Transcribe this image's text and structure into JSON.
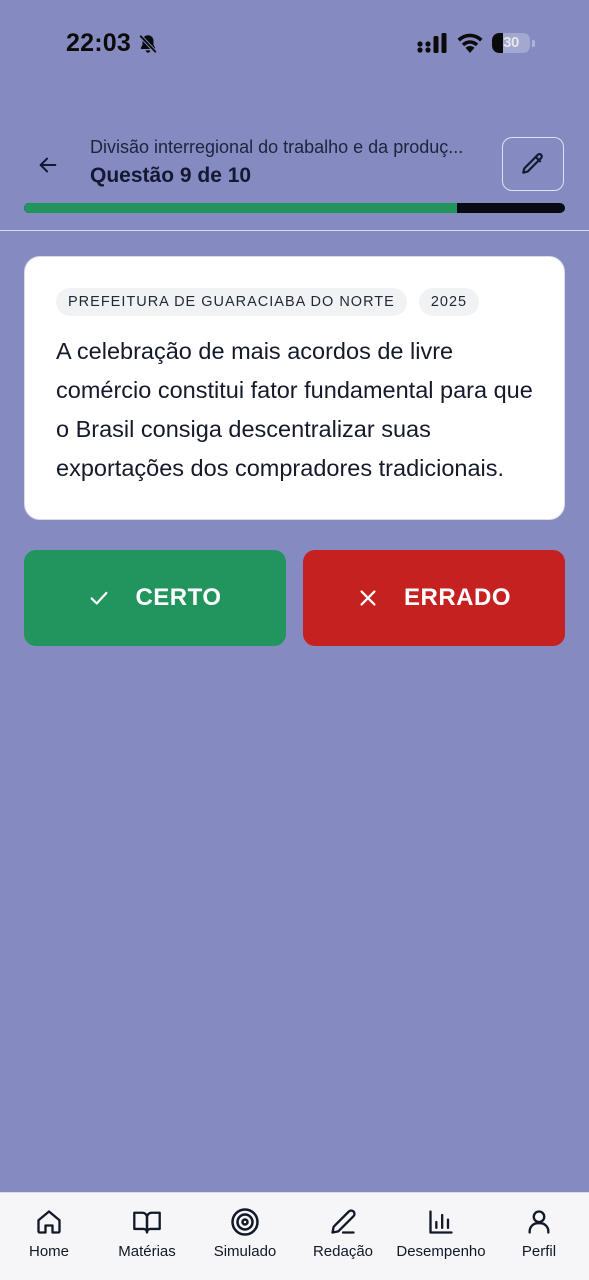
{
  "status_bar": {
    "time": "22:03",
    "battery_level": "30",
    "battery_fraction": 0.3,
    "icons": [
      "bell-slash-icon",
      "signal-icon",
      "wifi-icon",
      "battery-icon"
    ]
  },
  "header": {
    "subtitle": "Divisão interregional do trabalho e da produç...",
    "title": "Questão 9 de 10",
    "progress_fraction": 0.8,
    "back_icon": "arrow-left-icon",
    "edit_icon": "pencil-icon"
  },
  "card": {
    "tags": [
      "PREFEITURA DE GUARACIABA DO NORTE",
      "2025"
    ],
    "question": "A celebração de mais acordos de livre comércio constitui fator fundamental para que o Brasil consiga descentralizar suas exportações dos compradores tradicionais."
  },
  "answers": {
    "certo_label": "CERTO",
    "errado_label": "ERRADO",
    "certo_color": "#22955e",
    "errado_color": "#c62121"
  },
  "colors": {
    "background": "#858bc0",
    "progress": "#22955e"
  },
  "nav": {
    "items": [
      {
        "label": "Home",
        "icon": "home-icon"
      },
      {
        "label": "Matérias",
        "icon": "book-icon"
      },
      {
        "label": "Simulado",
        "icon": "target-icon"
      },
      {
        "label": "Redação",
        "icon": "pen-icon"
      },
      {
        "label": "Desempenho",
        "icon": "bar-chart-icon"
      },
      {
        "label": "Perfil",
        "icon": "user-icon"
      }
    ]
  }
}
